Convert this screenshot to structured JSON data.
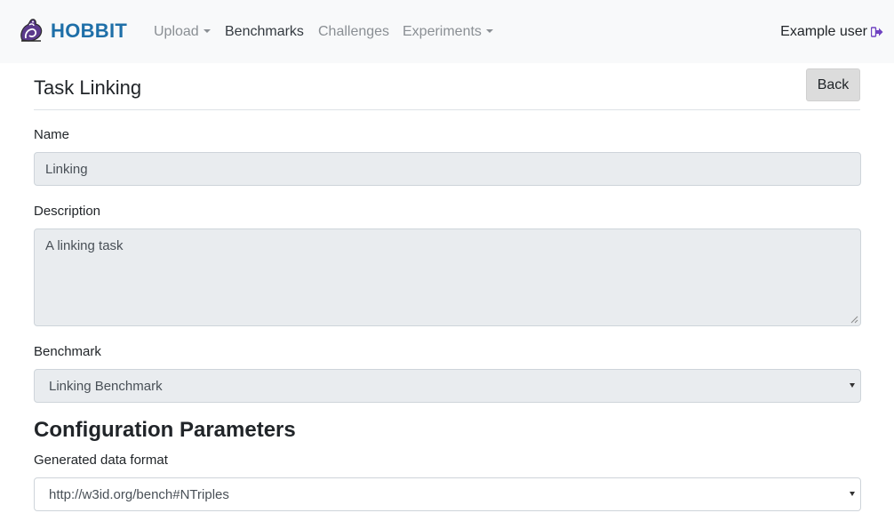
{
  "navbar": {
    "brand": "HOBBIT",
    "links": [
      {
        "label": "Upload",
        "dropdown": true
      },
      {
        "label": "Benchmarks",
        "dropdown": false,
        "active": true
      },
      {
        "label": "Challenges",
        "dropdown": false
      },
      {
        "label": "Experiments",
        "dropdown": true
      }
    ],
    "user": "Example user",
    "logout_icon": "sign-out-icon"
  },
  "page": {
    "title": "Task Linking",
    "back_label": "Back"
  },
  "form": {
    "name_label": "Name",
    "name_value": "Linking",
    "description_label": "Description",
    "description_value": "A linking task",
    "benchmark_label": "Benchmark",
    "benchmark_value": "Linking Benchmark"
  },
  "config": {
    "heading": "Configuration Parameters",
    "format_label": "Generated data format",
    "format_value": "http://w3id.org/bench#NTriples"
  },
  "colors": {
    "brand": "#1e6fa8",
    "navbar_bg": "#f8f9fa",
    "disabled_field_bg": "#e9ecef",
    "logout_icon": "#6f42c1"
  }
}
